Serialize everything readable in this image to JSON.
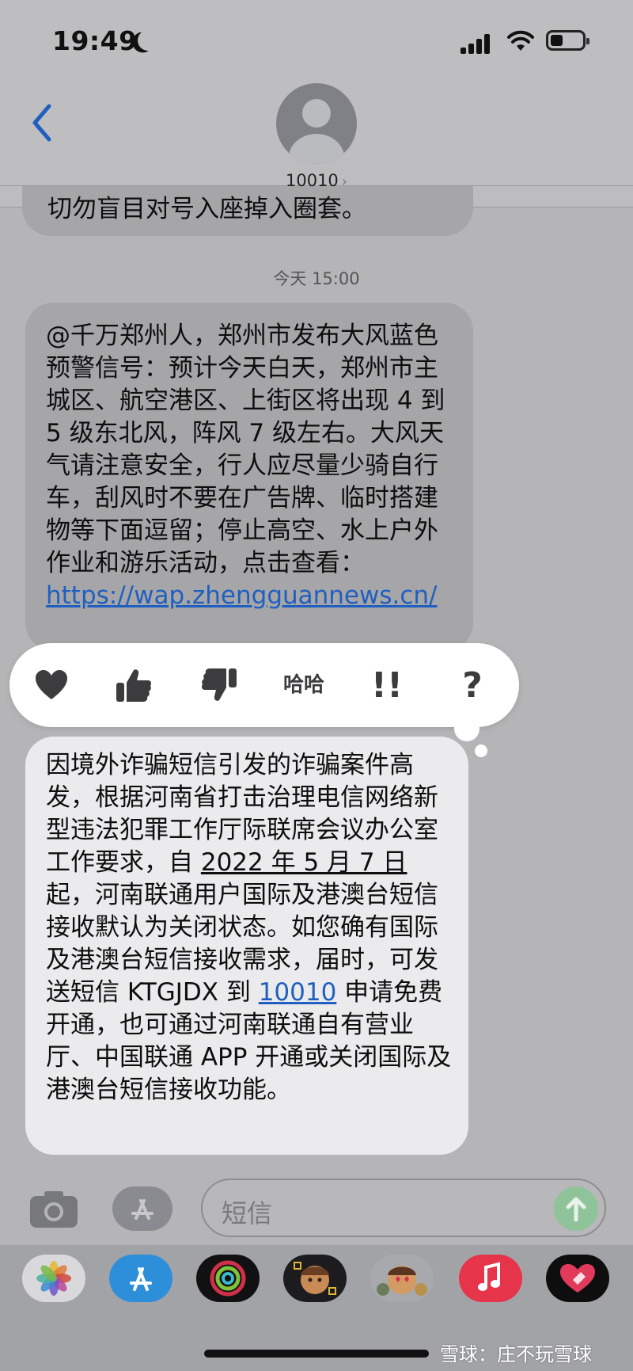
{
  "status_bar": {
    "time": "19:49"
  },
  "header": {
    "contact_name": "10010",
    "contact_chevron": "›"
  },
  "messages": {
    "cutoff_text": "切勿盲目对号入座掉入圈套。",
    "timestamp": "今天 15:00",
    "msg1_text": "@千万郑州人，郑州市发布大风蓝色预警信号：预计今天白天，郑州市主城区、航空港区、上街区将出现 4 到 5 级东北风，阵风 7 级左右。大风天气请注意安全，行人应尽量少骑自行车，刮风时不要在广告牌、临时搭建物等下面逗留；停止高空、水上户外作业和游乐活动，点击查看：",
    "msg1_link": "https://wap.zhengguannews.cn/",
    "msg2_before": "因境外诈骗短信引发的诈骗案件高发，根据河南省打击治理电信网络新型违法犯罪工作厅际联席会议办公室工作要求，自 ",
    "msg2_date": "2022 年 5 月 7 日",
    "msg2_mid": "起，河南联通用户国际及港澳台短信接收默认为关闭状态。如您确有国际及港澳台短信接收需求，届时，可发送短信 KTGJDX 到 ",
    "msg2_number": "10010",
    "msg2_after": " 申请免费开通，也可通过河南联通自有营业厅、中国联通 APP 开通或关闭国际及港澳台短信接收功能。"
  },
  "tapback": {
    "items": [
      "heart-icon",
      "thumbs-up-icon",
      "thumbs-down-icon",
      "haha-icon",
      "exclamation-icon",
      "question-icon"
    ],
    "haha_label": "哈哈",
    "exclamation_label": "!!",
    "question_label": "?"
  },
  "input": {
    "placeholder": "短信"
  },
  "app_drawer": {
    "apps": [
      "photos-app-icon",
      "app-store-icon",
      "activity-app-icon",
      "memoji-app-icon",
      "animoji-app-icon",
      "music-app-icon",
      "digital-touch-icon"
    ]
  },
  "watermark": "雪球：庄不玩雪球",
  "colors": {
    "link": "#1f5fbf",
    "incoming_bubble": "#ebebed",
    "send_button": "#8fc49a"
  }
}
